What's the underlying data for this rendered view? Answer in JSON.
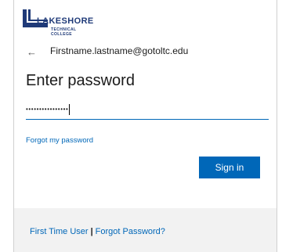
{
  "logo": {
    "name": "LAKESHORE",
    "line1": "TECHNICAL",
    "line2": "COLLEGE",
    "color": "#1f3a78"
  },
  "identity": {
    "back_icon": "back-arrow-icon",
    "email": "Firstname.lastname@gotoltc.edu"
  },
  "heading": "Enter password",
  "password": {
    "value_masked": "••••••••••••••••"
  },
  "forgot_link": "Forgot my password",
  "signin_label": "Sign in",
  "footer": {
    "first_time_user": "First Time User",
    "separator": "|",
    "forgot_password": "Forgot Password?"
  },
  "colors": {
    "accent": "#0067b8",
    "footer_bg": "#f2f2f2"
  }
}
